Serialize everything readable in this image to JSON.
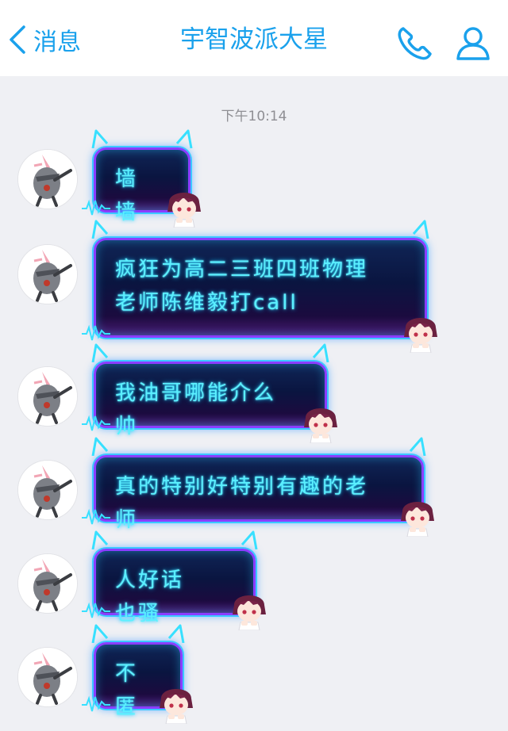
{
  "header": {
    "back_label": "消息",
    "title": "宇智波派大星",
    "phone_icon": "phone-icon",
    "contact_icon": "person-icon",
    "accent_color": "#1aa1ec"
  },
  "timestamp": "下午10:14",
  "messages": [
    {
      "text": "墙墙"
    },
    {
      "text": "疯狂为高二三班四班物理老师陈维毅打call"
    },
    {
      "text": "我油哥哪能介么帅"
    },
    {
      "text": "真的特别好特别有趣的老师"
    },
    {
      "text": "人好话也骚"
    },
    {
      "text": "不匿"
    }
  ],
  "bubble_theme": {
    "text_color": "#5bf0ff",
    "border_color": "#8b3dff",
    "glow_color": "#3cc8ff"
  }
}
